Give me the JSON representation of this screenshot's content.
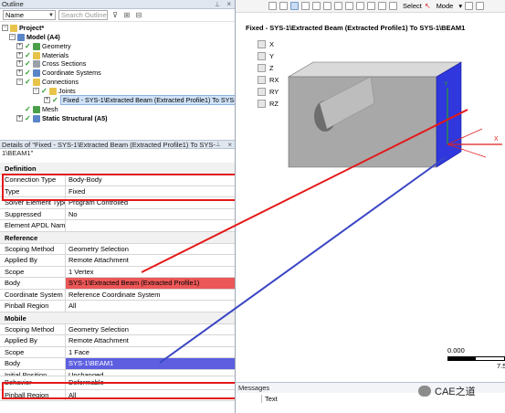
{
  "outline": {
    "title": "Outline",
    "filter_value": "Name",
    "search_placeholder": "Search Outline",
    "tree": [
      {
        "label": "Project*",
        "bold": true
      },
      {
        "label": "Model (A4)",
        "bold": true
      },
      {
        "label": "Geometry"
      },
      {
        "label": "Materials"
      },
      {
        "label": "Cross Sections"
      },
      {
        "label": "Coordinate Systems"
      },
      {
        "label": "Connections"
      },
      {
        "label": "Joints"
      },
      {
        "label": "Fixed - SYS-1\\Extracted Beam (Extracted Profile1) To SYS-1\\BEAM1"
      },
      {
        "label": "Mesh"
      },
      {
        "label": "Static Structural (A5)",
        "bold": true
      }
    ]
  },
  "details": {
    "title": "Details of \"Fixed - SYS-1\\Extracted Beam (Extracted Profile1) To SYS-1\\BEAM1\"",
    "sections": [
      {
        "name": "Definition",
        "rows": [
          {
            "key": "Connection Type",
            "value": "Body-Body"
          },
          {
            "key": "Type",
            "value": "Fixed"
          },
          {
            "key": "Solver Element Type",
            "value": "Program Controlled"
          },
          {
            "key": "Suppressed",
            "value": "No"
          },
          {
            "key": "Element APDL Name",
            "value": ""
          }
        ]
      },
      {
        "name": "Reference",
        "rows": [
          {
            "key": "Scoping Method",
            "value": "Geometry Selection"
          },
          {
            "key": "Applied By",
            "value": "Remote Attachment"
          },
          {
            "key": "Scope",
            "value": "1 Vertex"
          },
          {
            "key": "Body",
            "value": "SYS-1\\Extracted Beam (Extracted Profile1)",
            "highlight": "red"
          },
          {
            "key": "Coordinate System",
            "value": "Reference Coordinate System"
          },
          {
            "key": "Pinball Region",
            "value": "All"
          }
        ]
      },
      {
        "name": "Mobile",
        "rows": [
          {
            "key": "Scoping Method",
            "value": "Geometry Selection"
          },
          {
            "key": "Applied By",
            "value": "Remote Attachment"
          },
          {
            "key": "Scope",
            "value": "1 Face"
          },
          {
            "key": "Body",
            "value": "SYS-1\\BEAM1",
            "highlight": "blue"
          },
          {
            "key": "Initial Position",
            "value": "Unchanged"
          },
          {
            "key": "Behavior",
            "value": "Deformable"
          },
          {
            "key": "Pinball Region",
            "value": "All"
          }
        ]
      }
    ]
  },
  "toolbar": {
    "select_label": "Select",
    "mode_label": "Mode"
  },
  "viewport": {
    "title": "Fixed - SYS-1\\Extracted Beam (Extracted Profile1) To SYS-1\\BEAM1",
    "dof": [
      "X",
      "Y",
      "Z",
      "RX",
      "RY",
      "RZ"
    ],
    "scale_zero": "0.000",
    "scale_end": "7.5",
    "axis_x": "X",
    "axis_y": "Y"
  },
  "messages": {
    "title": "Messages",
    "column_text": "Text"
  },
  "watermark": {
    "text": "CAE之道"
  },
  "colors": {
    "annotation_red": "#e31919",
    "annotation_blue": "#3b46c4",
    "body_red": "#ec5757",
    "body_blue": "#5d5fe0",
    "face_blue": "#3b3fe0"
  }
}
